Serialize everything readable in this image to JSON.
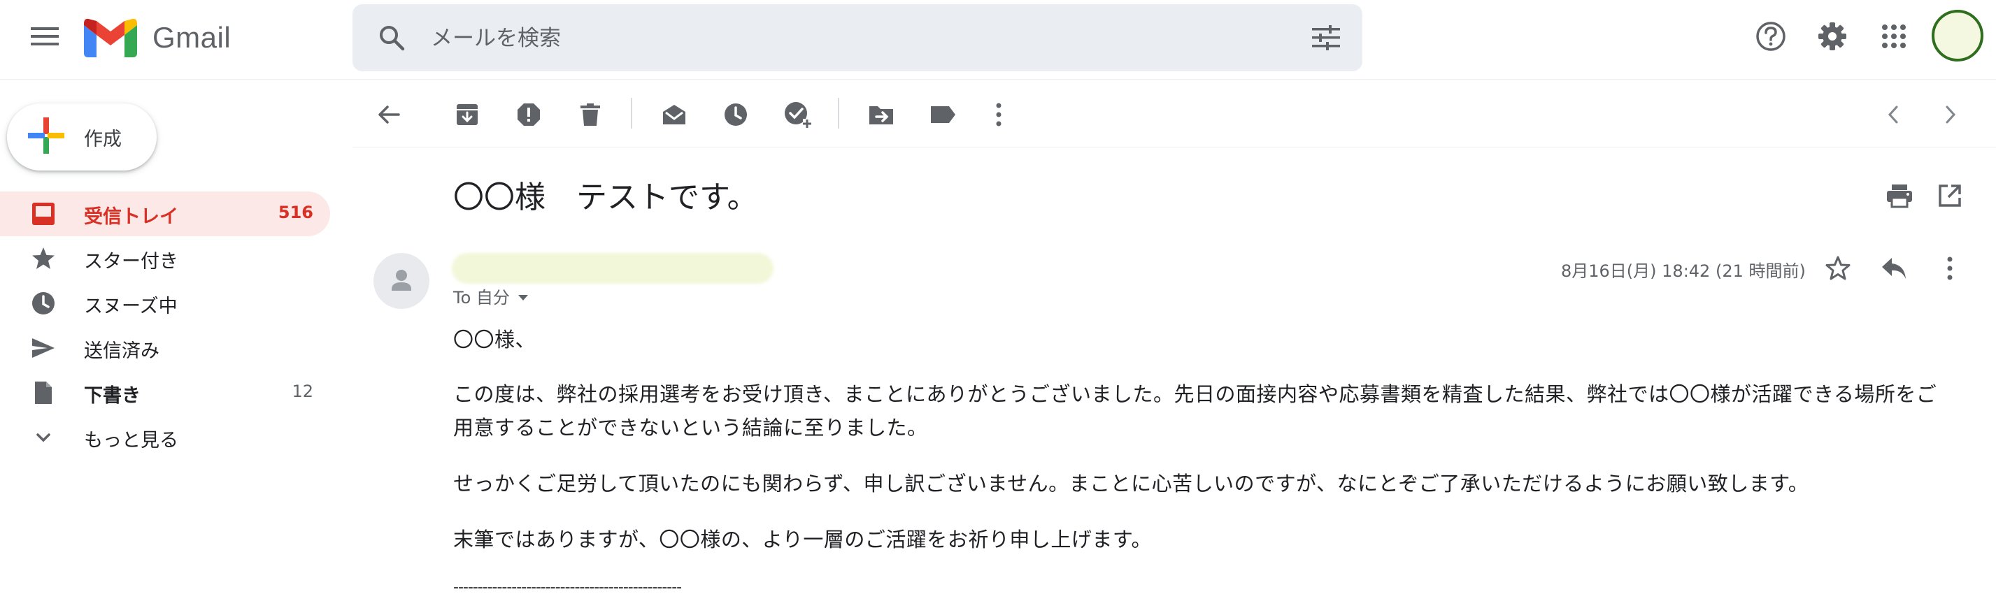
{
  "app": {
    "name": "Gmail",
    "icons": [
      "menu-icon",
      "gmail-logo",
      "search-icon",
      "tune-icon",
      "help-icon",
      "settings-icon",
      "apps-icon"
    ]
  },
  "search": {
    "placeholder": "メールを検索",
    "value": ""
  },
  "compose": {
    "label": "作成"
  },
  "nav": {
    "items": [
      {
        "label": "受信トレイ",
        "count": "516",
        "icon": "inbox-icon",
        "active": true
      },
      {
        "label": "スター付き",
        "count": "",
        "icon": "star-icon"
      },
      {
        "label": "スヌーズ中",
        "count": "",
        "icon": "clock-icon"
      },
      {
        "label": "送信済み",
        "count": "",
        "icon": "send-icon"
      },
      {
        "label": "下書き",
        "count": "12",
        "icon": "draft-icon"
      },
      {
        "label": "もっと見る",
        "count": "",
        "icon": "expand-icon"
      }
    ]
  },
  "toolbar": {
    "icons": [
      "back-icon",
      "archive-icon",
      "report-spam-icon",
      "delete-icon",
      "mark-unread-icon",
      "snooze-icon",
      "add-task-icon",
      "move-to-icon",
      "label-icon",
      "more-vert-icon",
      "newer-icon",
      "older-icon"
    ]
  },
  "message": {
    "subject": "〇〇様　テストです。",
    "to": "To 自分",
    "date": "8月16日(月) 18:42 (21 時間前)",
    "body": [
      "〇〇様、",
      "この度は、弊社の採用選考をお受け頂き、まことにありがとうございました。先日の面接内容や応募書類を精査した結果、弊社では〇〇様が活躍できる場所をご用意することができないという結論に至りました。",
      "せっかくご足労して頂いたのにも関わらず、申し訳ございません。まことに心苦しいのですが、なにとぞご了承いただけるようにお願い致します。",
      "末筆ではありますが、〇〇様の、より一層のご活躍をお祈り申し上げます。"
    ],
    "signature_rule": "-----------------------------------------------"
  },
  "colors": {
    "accent_red": "#d93025",
    "active_bg": "#fce8e6",
    "search_bg": "#eaeef2",
    "icon_gray": "#5f6368"
  }
}
